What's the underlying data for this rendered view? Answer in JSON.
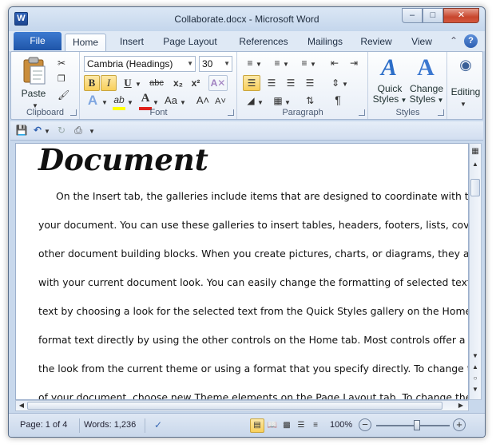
{
  "window": {
    "app_icon": "W",
    "title": "Collaborate.docx - Microsoft Word",
    "minimize_icon": "–",
    "maximize_icon": "□",
    "close_icon": "✕"
  },
  "tabs": {
    "file": "File",
    "items": [
      "Home",
      "Insert",
      "Page Layout",
      "References",
      "Mailings",
      "Review",
      "View"
    ],
    "active": "Home",
    "help_icon": "?"
  },
  "ribbon": {
    "clipboard": {
      "label": "Clipboard",
      "paste": "Paste"
    },
    "font": {
      "label": "Font",
      "font_name": "Cambria (Headings)",
      "font_size": "30",
      "bold": "B",
      "italic": "I",
      "underline": "U",
      "strikethrough": "abc",
      "subscript": "x₂",
      "superscript": "x²",
      "grow": "A˄",
      "shrink": "A˅",
      "change_case": "Aa",
      "font_color_letter": "A",
      "highlight_letter": "ab"
    },
    "paragraph": {
      "label": "Paragraph",
      "pilcrow": "¶"
    },
    "styles": {
      "label": "Styles",
      "quick": "Quick",
      "quick2": "Styles",
      "change": "Change",
      "change2": "Styles"
    },
    "editing": {
      "label": "Editing"
    }
  },
  "document": {
    "title": "Document",
    "lines": [
      "On the Insert tab, the galleries include items that are designed to coordinate with the",
      "your document. You can use these galleries to insert tables, headers, footers, lists, cover p",
      "other document building blocks. When you create pictures, charts, or diagrams, they also c",
      "with your current document look. You can easily change the formatting of selected text in",
      "text by choosing a look for the selected text from the Quick Styles gallery on the Home tab",
      "format text directly by using the other controls on the Home tab. Most controls offer a cho",
      "the look from the current theme or using a format that you specify directly. To change the",
      "of your document, choose new Theme elements on the Page Layout tab. To change the loo"
    ]
  },
  "status": {
    "page": "Page: 1 of 4",
    "words": "Words: 1,236",
    "zoom": "100%",
    "zoom_out": "−",
    "zoom_in": "+",
    "zoom_level": 0.55
  },
  "colors": {
    "accent": "#2b5fb0",
    "selected": "#f8cf5a",
    "font_color": "#e0201b",
    "highlight": "#ffff00"
  }
}
